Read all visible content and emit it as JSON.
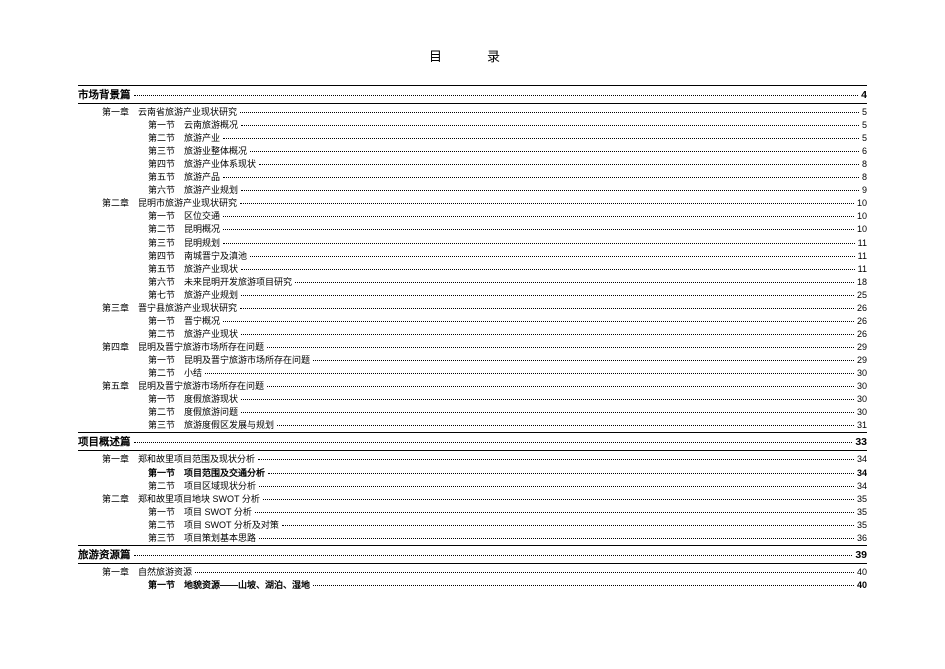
{
  "title": "目　录",
  "entries": [
    {
      "level": "section",
      "label": "市场背景篇",
      "page": "4"
    },
    {
      "level": "chapter",
      "label": "第一章　云南省旅游产业现状研究",
      "page": "5"
    },
    {
      "level": "sub",
      "label": "第一节　云南旅游概况",
      "page": "5"
    },
    {
      "level": "sub",
      "label": "第二节　旅游产业",
      "page": "5"
    },
    {
      "level": "sub",
      "label": "第三节　旅游业整体概况",
      "page": "6"
    },
    {
      "level": "sub",
      "label": "第四节　旅游产业体系现状",
      "page": "8"
    },
    {
      "level": "sub",
      "label": "第五节　旅游产品",
      "page": "8"
    },
    {
      "level": "sub",
      "label": "第六节　旅游产业规划",
      "page": "9"
    },
    {
      "level": "chapter",
      "label": "第二章　昆明市旅游产业现状研究",
      "page": "10"
    },
    {
      "level": "sub",
      "label": "第一节　区位交通",
      "page": "10"
    },
    {
      "level": "sub",
      "label": "第二节　昆明概况",
      "page": "10"
    },
    {
      "level": "sub",
      "label": "第三节　昆明规划",
      "page": "11"
    },
    {
      "level": "sub",
      "label": "第四节　南城晋宁及滇池",
      "page": "11"
    },
    {
      "level": "sub",
      "label": "第五节　旅游产业现状",
      "page": "11"
    },
    {
      "level": "sub",
      "label": "第六节　未来昆明开发旅游项目研究",
      "page": "18"
    },
    {
      "level": "sub",
      "label": "第七节　旅游产业规划",
      "page": "25"
    },
    {
      "level": "chapter",
      "label": "第三章　晋宁县旅游产业现状研究",
      "page": "26"
    },
    {
      "level": "sub",
      "label": "第一节　晋宁概况",
      "page": "26"
    },
    {
      "level": "sub",
      "label": "第二节　旅游产业现状",
      "page": "26"
    },
    {
      "level": "chapter",
      "label": "第四章　昆明及晋宁旅游市场所存在问题",
      "page": "29"
    },
    {
      "level": "sub",
      "label": "第一节　昆明及晋宁旅游市场所存在问题",
      "page": "29"
    },
    {
      "level": "sub",
      "label": "第二节　小结",
      "page": "30"
    },
    {
      "level": "chapter",
      "label": "第五章　昆明及晋宁旅游市场所存在问题",
      "page": "30"
    },
    {
      "level": "sub",
      "label": "第一节　度假旅游现状",
      "page": "30"
    },
    {
      "level": "sub",
      "label": "第二节　度假旅游问题",
      "page": "30"
    },
    {
      "level": "sub",
      "label": "第三节　旅游度假区发展与规划",
      "page": "31"
    },
    {
      "level": "section",
      "label": "项目概述篇",
      "page": "33"
    },
    {
      "level": "chapter",
      "label": "第一章　郑和故里项目范围及现状分析",
      "page": "34"
    },
    {
      "level": "subbold",
      "label": "第一节　项目范围及交通分析",
      "page": "34"
    },
    {
      "level": "sub",
      "label": "第二节　项目区域现状分析",
      "page": "34"
    },
    {
      "level": "chapter",
      "label": "第二章　郑和故里项目地块 SWOT 分析",
      "page": "35"
    },
    {
      "level": "sub",
      "label": "第一节　项目 SWOT 分析",
      "page": "35"
    },
    {
      "level": "sub",
      "label": "第二节　项目 SWOT 分析及对策",
      "page": "35"
    },
    {
      "level": "sub",
      "label": "第三节　项目策划基本思路",
      "page": "36"
    },
    {
      "level": "section",
      "label": "旅游资源篇",
      "page": "39"
    },
    {
      "level": "chapter",
      "label": "第一章　自然旅游资源",
      "page": "40"
    },
    {
      "level": "subbold",
      "label": "第一节　地貌资源——山坡、湖泊、湿地",
      "page": "40"
    }
  ]
}
